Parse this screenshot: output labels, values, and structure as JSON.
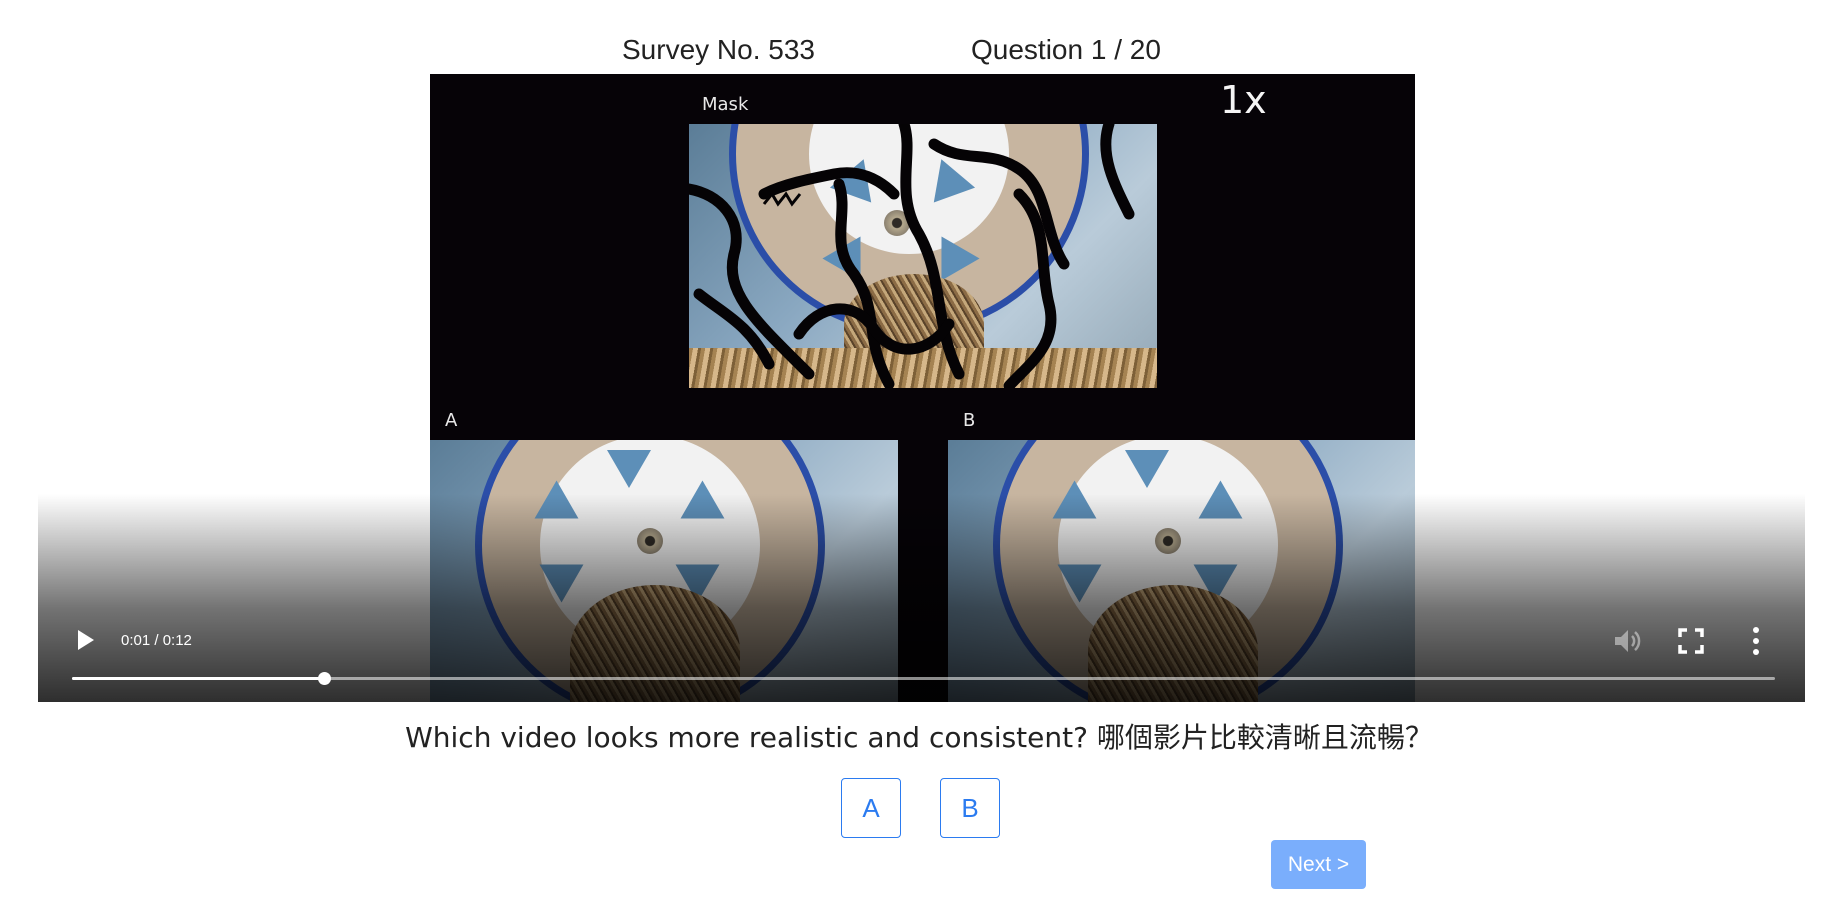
{
  "header": {
    "survey_label": "Survey No. 533",
    "question_progress": "Question 1 / 20"
  },
  "video": {
    "panel_labels": {
      "mask": "Mask",
      "a": "A",
      "b": "B"
    },
    "speed_indicator": "1x",
    "time_display": "0:01 / 0:12",
    "progress_fraction": 0.148,
    "muted": true
  },
  "question": {
    "text": "Which video looks more realistic and consistent? 哪個影片比較清晰且流暢？"
  },
  "choices": [
    {
      "label": "A"
    },
    {
      "label": "B"
    }
  ],
  "next_button": {
    "label": "Next >"
  },
  "colors": {
    "accent": "#2b7bf0",
    "next_button_bg": "#7aaefc",
    "video_bg": "#060307"
  }
}
